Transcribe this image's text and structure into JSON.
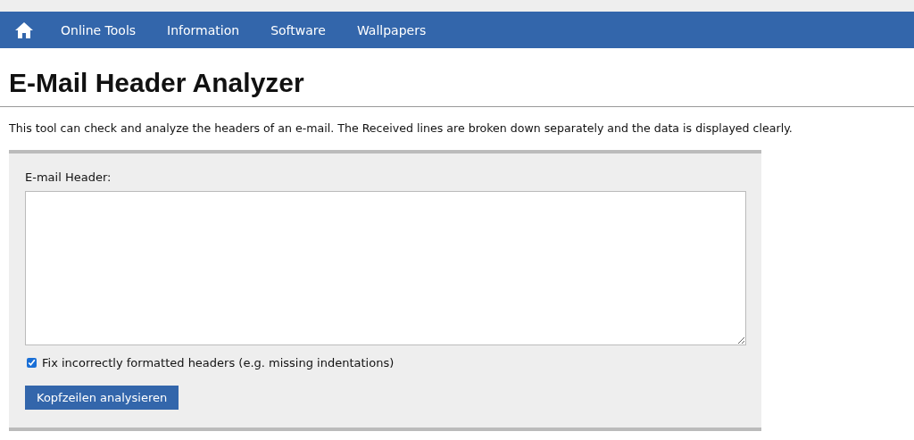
{
  "nav": {
    "items": [
      {
        "label": "Online Tools"
      },
      {
        "label": "Information"
      },
      {
        "label": "Software"
      },
      {
        "label": "Wallpapers"
      }
    ]
  },
  "title": "E-Mail Header Analyzer",
  "description": "This tool can check and analyze the headers of an e-mail. The Received lines are broken down separately and the data is displayed clearly.",
  "form": {
    "label": "E-mail Header:",
    "fix_option": {
      "label": "Fix incorrectly formatted headers (e.g. missing indentations)",
      "checked": true
    },
    "submit": "Kopfzeilen analysieren"
  }
}
